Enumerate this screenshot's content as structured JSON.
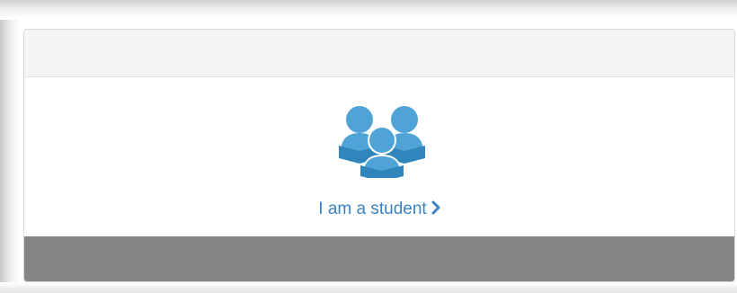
{
  "colors": {
    "accent": "#3a83c5",
    "icon_blue": "#4fa3d6",
    "icon_dark": "#2f86bd",
    "header_bg": "#f5f5f5",
    "footer_bg": "#858585"
  },
  "panel": {
    "role_option": {
      "icon": "students-icon",
      "label": "I am a student",
      "chevron_icon": "chevron-right-icon"
    }
  }
}
